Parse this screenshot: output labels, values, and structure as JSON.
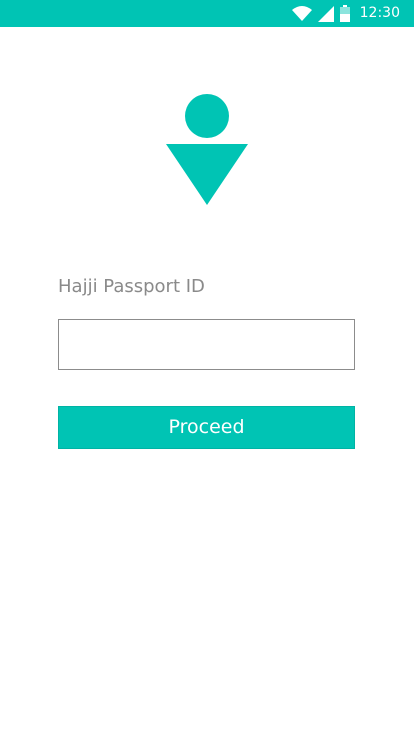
{
  "status_bar": {
    "time": "12:30",
    "icons": [
      "wifi-icon",
      "cell-signal-icon",
      "battery-icon"
    ],
    "color": "#00c4b4"
  },
  "logo": {
    "icon": "person-pin-icon",
    "color": "#00c4b4"
  },
  "form": {
    "label": "Hajji Passport ID",
    "input_value": "",
    "input_placeholder": "",
    "proceed_label": "Proceed"
  },
  "colors": {
    "accent": "#00c4b4",
    "label_text": "#8a8a8a",
    "background": "#ffffff"
  }
}
